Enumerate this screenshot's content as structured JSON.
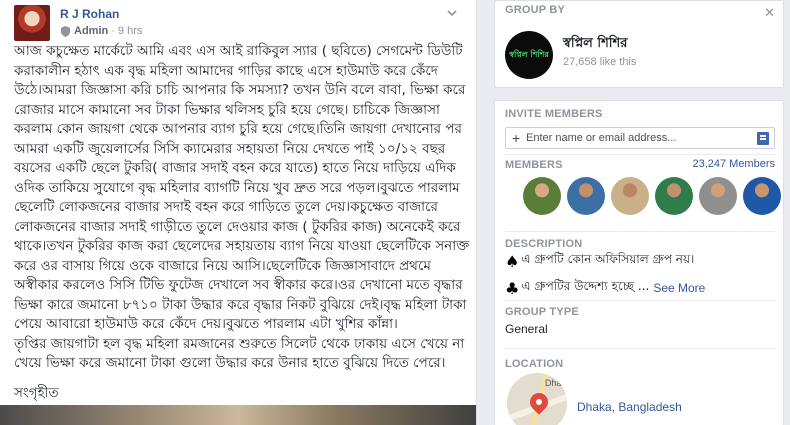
{
  "post": {
    "author": "R J Rohan",
    "role": "Admin",
    "time": "9 hrs",
    "paragraphs": [
      "আজ কচুক্ষেত মার্কেটে আমি এবং এস আই রাকিবুল স্যার ( ছবিতে) সেগমেন্ট ডিউটি করাকালীন হঠাৎ এক বৃদ্ধ মহিলা আমাদের গাড়ির কাছে এসে হাউমাউ করে কেঁদে উঠে।আমরা জিজ্ঞাসা করি চাচি আপনার কি সমস্যা? তখন উনি বলে বাবা, ভিক্ষা করে রোজার মাসে কামানো সব টাকা ভিক্ষার থলিসহ চুরি হয়ে গেছে। চাচিকে জিজ্ঞাসা করলাম কোন জায়গা থেকে আপনার ব্যাগ চুরি হয়ে গেছে।তিনি জায়গা দেখানোর পর আমরা একটি জুয়েলার্সের সিসি ক্যামেরার সহায়তা নিয়ে দেখতে পাই ১০/১২ বছর বয়সের একটি ছেলে টুকরি( বাজার সদাই বহন করে যাতে) হাতে নিয়ে দাড়িয়ে এদিক ওদিক তাকিয়ে সুযোগে বৃদ্ধ মহিলার ব্যাগটি নিয়ে খুব দ্রুত সরে পড়ল।বুঝতে পারলাম ছেলেটি লোকজনের বাজার সদাই বহন করে গাড়িতে তুলে দেয়।কচুক্ষেত বাজারে লোকজনের বাজার সদাই গাড়ীতে তুলে দেওয়ার কাজ ( টুকরির কাজ) অনেকেই করে থাকে।তখন টুকরির কাজ করা ছেলেদের সহায়তায় ব্যাগ নিয়ে যাওয়া ছেলেটিকে সনাক্ত করে ওর বাসায় গিয়ে ওকে বাজারে নিয়ে আসি।ছেলেটিকে জিজ্ঞাসাবাদে প্রথমে অস্বীকার করলেও সিসি টিভি ফুটেজ দেখালে সব স্বীকার করে।ওর দেখানো মতে বৃদ্ধার ভিক্ষা কারে জমানো ৮৭১০ টাকা উদ্ধার করে বৃদ্ধার নিকট বুঝিয়ে দেই।বৃদ্ধ মহিলা টাকা পেয়ে আবারো হাউমাউ করে কেঁদে দেয়।বুঝতে পারলাম এটা খুশির কাঁন্না।",
      "তৃপ্তির জায়গাটা হল বৃদ্ধ মহিলা রমজানের শুরুতে সিলেট থেকে ঢাকায় এসে খেয়ে না খেয়ে ভিক্ষা করে জমানো টাকা গুলো উদ্ধার করে উনার হাতে বুঝিয়ে দিতে পেরে।"
    ],
    "signature": "সংগৃহীত"
  },
  "sidebar": {
    "group_by_title": "GROUP BY",
    "group_name": "স্বপ্নিল শিশির",
    "group_logo_text": "স্বপ্নিল শিশির",
    "group_likes": "27,658 like this",
    "invite_title": "INVITE MEMBERS",
    "invite_placeholder": "Enter name or email address...",
    "members_title": "MEMBERS",
    "members_count": "23,247 Members",
    "description_title": "DESCRIPTION",
    "description_line1": "এ গ্রুপটি কোন অফিসিয়াল গ্রুপ নয়।",
    "description_line2": "এ গ্রুপটির উদ্দেশ্য হচ্ছে ...",
    "see_more": "See More",
    "group_type_title": "GROUP TYPE",
    "group_type": "General",
    "location_title": "LOCATION",
    "map_label": "Dhak",
    "location": "Dhaka, Bangladesh"
  },
  "colors": {
    "link": "#365899",
    "secondary_text": "#90949c",
    "page_bg": "#e9ebee",
    "map_pin": "#e0493d"
  }
}
